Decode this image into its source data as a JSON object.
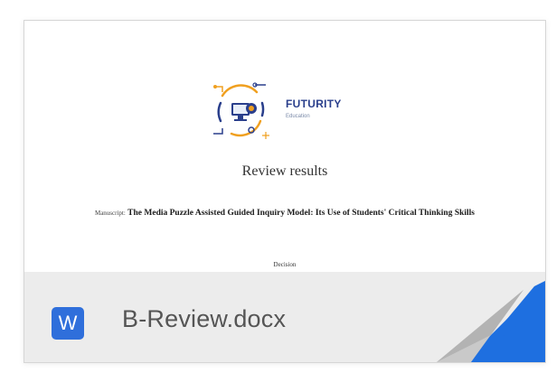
{
  "preview": {
    "brand_name": "FUTURITY",
    "brand_sub": "Education",
    "title": "Review results",
    "manuscript_label": "Manuscript:",
    "manuscript_title": "The Media Puzzle Assisted Guided Inquiry Model: Its Use of Students' Critical Thinking Skills",
    "decision_label": "Decision"
  },
  "file": {
    "icon_letter": "W",
    "name": "B-Review.docx"
  },
  "colors": {
    "word_blue": "#2f6fdb",
    "brand_navy": "#2a3f8c",
    "logo_orange": "#f0a020",
    "curl_blue": "#1e6fe0",
    "footer_gray": "#ececec"
  },
  "icons": {
    "word": "word-doc-icon",
    "logo": "futurity-logo-icon",
    "curl": "page-curl-icon"
  }
}
